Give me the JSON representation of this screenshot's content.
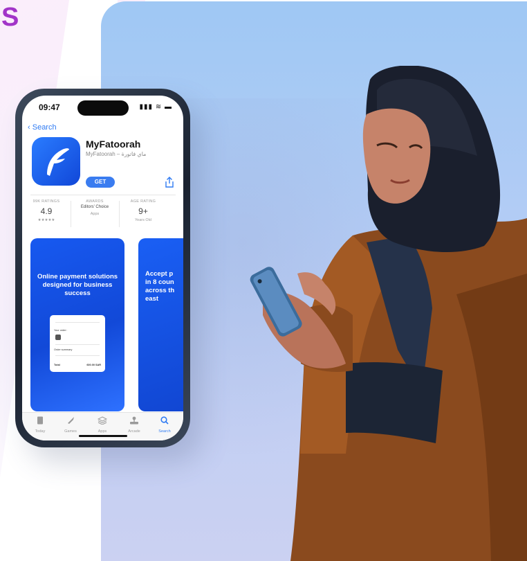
{
  "corner_letter": "S",
  "phone": {
    "status": {
      "time": "09:47",
      "icons": "▮▮▮ ≋ ▬"
    },
    "back_label": "Search",
    "app": {
      "name": "MyFatoorah",
      "subtitle": "MyFatoorah – ماي فاتورة",
      "get_label": "GET"
    },
    "stats": [
      {
        "label": "99K RATINGS",
        "value": "4.9",
        "foot": "★★★★★"
      },
      {
        "label": "AWARDS",
        "value": "Editors' Choice",
        "foot": "Apps"
      },
      {
        "label": "AGE RATING",
        "value": "9+",
        "foot": "Years Old"
      }
    ],
    "screenshots": {
      "first_caption": "Online payment solutions designed for business success",
      "second_caption": "Accept p\nin 8 coun\nacross th\neast",
      "receipt": {
        "order_label": "Your order:",
        "summary_label": "Order summary",
        "total_label": "Total",
        "total_value": "600.00 SAR"
      }
    },
    "tabs": [
      {
        "label": "Today",
        "icon": "today-icon"
      },
      {
        "label": "Games",
        "icon": "rocket-icon"
      },
      {
        "label": "Apps",
        "icon": "apps-stack-icon"
      },
      {
        "label": "Arcade",
        "icon": "arcade-icon"
      },
      {
        "label": "Search",
        "icon": "search-icon",
        "active": true
      }
    ]
  },
  "colors": {
    "accent_purple": "#a234c8",
    "app_blue": "#1a5ff4",
    "ios_link_blue": "#2f7bf3",
    "hero_bg": "#a8c8f4"
  }
}
